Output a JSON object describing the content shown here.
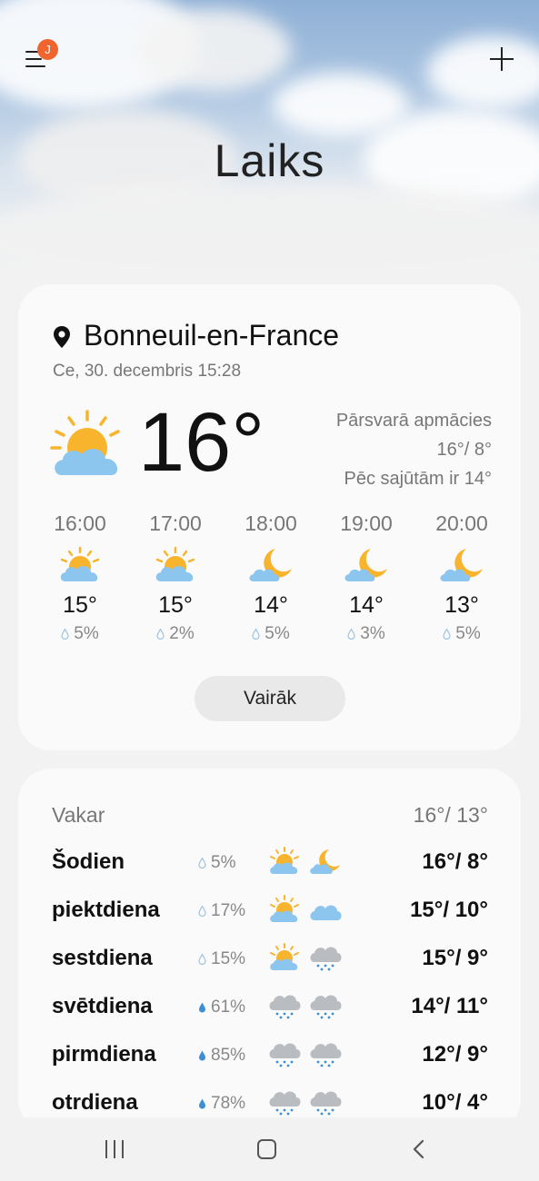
{
  "header": {
    "title": "Laiks",
    "badge": "J",
    "menu_icon": "hamburger-menu-icon",
    "add_icon": "plus-icon"
  },
  "current": {
    "location": "Bonneuil-en-France",
    "datetime": "Ce, 30. decembris 15:28",
    "temp": "16°",
    "condition": "Pārsvarā apmācies",
    "hi_lo": "16°/ 8°",
    "feels_like": "Pēc sajūtām ir 14°",
    "icon": "partly-sunny-icon"
  },
  "hourly": [
    {
      "time": "16:00",
      "icon": "partly-sunny-icon",
      "temp": "15°",
      "precip": "5%"
    },
    {
      "time": "17:00",
      "icon": "partly-sunny-icon",
      "temp": "15°",
      "precip": "2%"
    },
    {
      "time": "18:00",
      "icon": "partly-cloudy-night-icon",
      "temp": "14°",
      "precip": "5%"
    },
    {
      "time": "19:00",
      "icon": "partly-cloudy-night-icon",
      "temp": "14°",
      "precip": "3%"
    },
    {
      "time": "20:00",
      "icon": "partly-cloudy-night-icon",
      "temp": "13°",
      "precip": "5%"
    }
  ],
  "more_button": "Vairāk",
  "yesterday": {
    "label": "Vakar",
    "temps": "16°/ 13°"
  },
  "daily": [
    {
      "day": "Šodien",
      "precip": "5%",
      "icon_day": "partly-sunny-icon",
      "icon_night": "partly-cloudy-night-icon",
      "temps": "16°/ 8°"
    },
    {
      "day": "piektdiena",
      "precip": "17%",
      "icon_day": "partly-sunny-icon",
      "icon_night": "cloud-icon",
      "temps": "15°/ 10°"
    },
    {
      "day": "sestdiena",
      "precip": "15%",
      "icon_day": "partly-sunny-icon",
      "icon_night": "rain-cloud-icon",
      "temps": "15°/ 9°"
    },
    {
      "day": "svētdiena",
      "precip": "61%",
      "icon_day": "rain-cloud-icon",
      "icon_night": "rain-cloud-icon",
      "temps": "14°/ 11°"
    },
    {
      "day": "pirmdiena",
      "precip": "85%",
      "icon_day": "rain-cloud-icon",
      "icon_night": "rain-cloud-icon",
      "temps": "12°/ 9°"
    },
    {
      "day": "otrdiena",
      "precip": "78%",
      "icon_day": "rain-cloud-icon",
      "icon_night": "rain-cloud-icon",
      "temps": "10°/ 4°"
    }
  ],
  "colors": {
    "sun": "#f7b42c",
    "cloud_blue": "#8cc5ee",
    "cloud_grey": "#b9bcc0",
    "badge": "#f0642e",
    "drop_light": "#9fc4e0",
    "drop_dark": "#3d8fd4"
  }
}
